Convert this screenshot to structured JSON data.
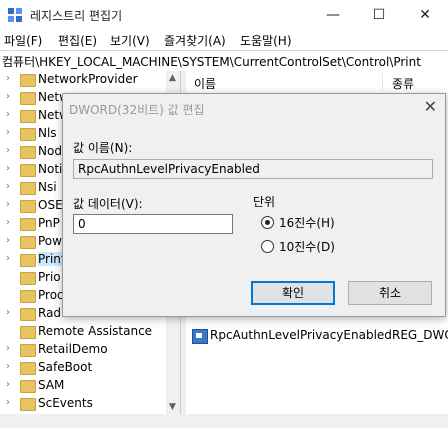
{
  "window": {
    "title": "레지스트리 편집기",
    "minimize": "—",
    "maximize": "☐",
    "close": "✕"
  },
  "menu": {
    "items": [
      "파일(F)",
      "편집(E)",
      "보기(V)",
      "즐겨찾기(A)",
      "도움말(H)"
    ]
  },
  "address": "컴퓨터\\HKEY_LOCAL_MACHINE\\SYSTEM\\CurrentControlSet\\Control\\Print",
  "tree": {
    "items": [
      {
        "label": "NetworkProvider",
        "has_children": true
      },
      {
        "label": "Netw",
        "has_children": true
      },
      {
        "label": "Netw",
        "has_children": true
      },
      {
        "label": "Nls",
        "has_children": true
      },
      {
        "label": "Nod",
        "has_children": true
      },
      {
        "label": "Noti",
        "has_children": true
      },
      {
        "label": "Nsi",
        "has_children": true
      },
      {
        "label": "OSE",
        "has_children": true
      },
      {
        "label": "PnP",
        "has_children": true
      },
      {
        "label": "Pow",
        "has_children": true
      },
      {
        "label": "Print",
        "has_children": true,
        "selected": true
      },
      {
        "label": "Prio",
        "has_children": false
      },
      {
        "label": "Proc",
        "has_children": false
      },
      {
        "label": "Radi",
        "has_children": true
      },
      {
        "label": "Remote Assistance",
        "has_children": false
      },
      {
        "label": "RetailDemo",
        "has_children": true
      },
      {
        "label": "SafeBoot",
        "has_children": true
      },
      {
        "label": "SAM",
        "has_children": true
      },
      {
        "label": "ScEvents",
        "has_children": true
      }
    ]
  },
  "list": {
    "col_name": "이름",
    "col_type": "종류",
    "row": {
      "name": "RpcAuthnLevelPrivacyEnabled",
      "type": "REG_DWO"
    }
  },
  "dialog": {
    "title": "DWORD(32비트) 값 편집",
    "close": "✕",
    "value_name_label": "값 이름(N):",
    "value_name": "RpcAuthnLevelPrivacyEnabled",
    "value_data_label": "값 데이터(V):",
    "value_data": "0",
    "base_label": "단위",
    "hex_label": "16진수(H)",
    "dec_label": "10진수(D)",
    "hex_selected": true,
    "ok_label": "확인",
    "cancel_label": "취소"
  },
  "colors": {
    "accent": "#0078d7",
    "selection": "#cce8ff",
    "folder": "#e8c35e"
  }
}
